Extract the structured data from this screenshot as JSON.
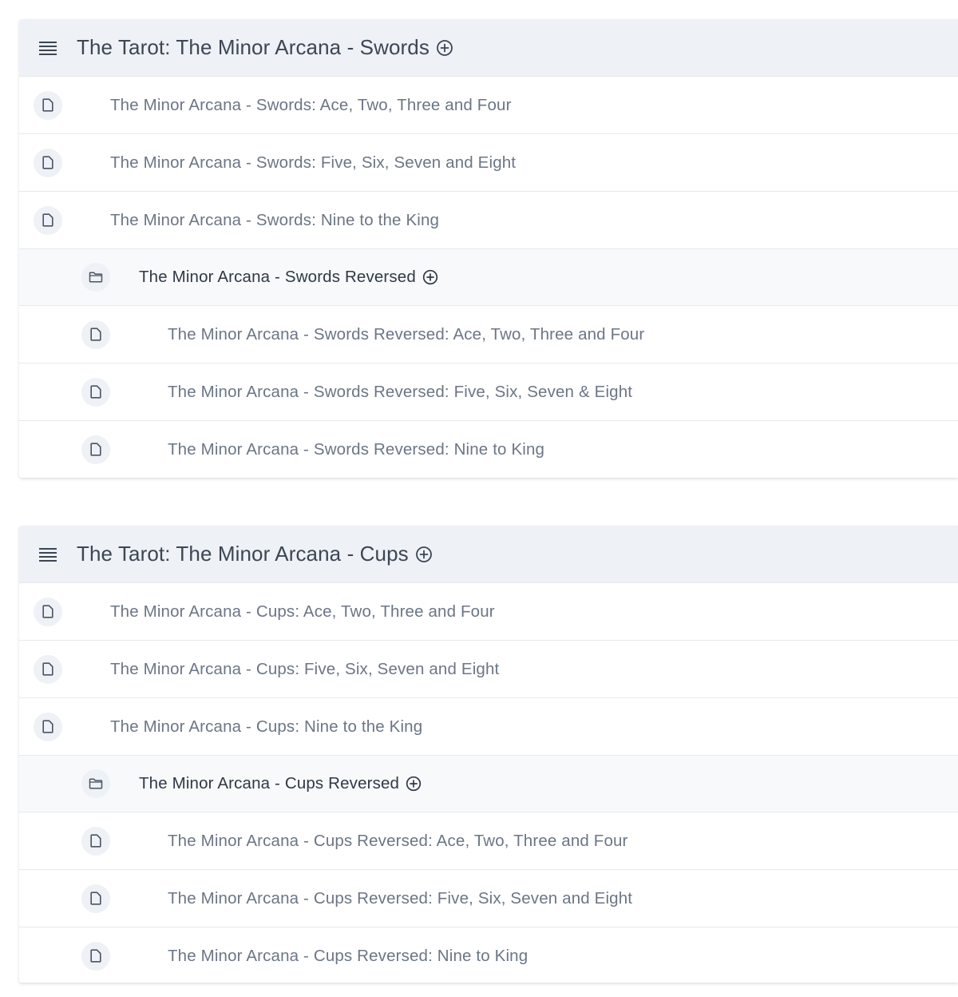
{
  "sections": [
    {
      "title": "The Tarot: The Minor Arcana - Swords",
      "items": [
        "The Minor Arcana - Swords: Ace, Two, Three and Four",
        "The Minor Arcana - Swords: Five, Six, Seven and Eight",
        "The Minor Arcana - Swords: Nine to the King"
      ],
      "subfolder": {
        "title": "The Minor Arcana - Swords Reversed",
        "items": [
          "The Minor Arcana - Swords Reversed: Ace, Two, Three and Four",
          "The Minor Arcana - Swords Reversed: Five, Six, Seven & Eight",
          "The Minor Arcana - Swords Reversed: Nine to King"
        ]
      }
    },
    {
      "title": "The Tarot: The Minor Arcana - Cups",
      "items": [
        "The Minor Arcana - Cups: Ace, Two, Three and Four",
        "The Minor Arcana - Cups: Five, Six, Seven and Eight",
        "The Minor Arcana - Cups: Nine to the King"
      ],
      "subfolder": {
        "title": "The Minor Arcana - Cups Reversed",
        "items": [
          "The Minor Arcana - Cups Reversed: Ace, Two, Three and Four",
          "The Minor Arcana - Cups Reversed: Five, Six, Seven and Eight",
          "The Minor Arcana - Cups Reversed: Nine to King"
        ]
      }
    }
  ],
  "icons": {
    "section_menu": "list-icon",
    "add": "plus-circle-icon",
    "document": "document-icon",
    "folder": "folder-icon"
  },
  "colors": {
    "header_bg": "#eef1f5",
    "subfolder_bg": "#f8f9fb",
    "title_text": "#3d4654",
    "item_text": "#6b7686",
    "subfolder_text": "#2f3947"
  }
}
